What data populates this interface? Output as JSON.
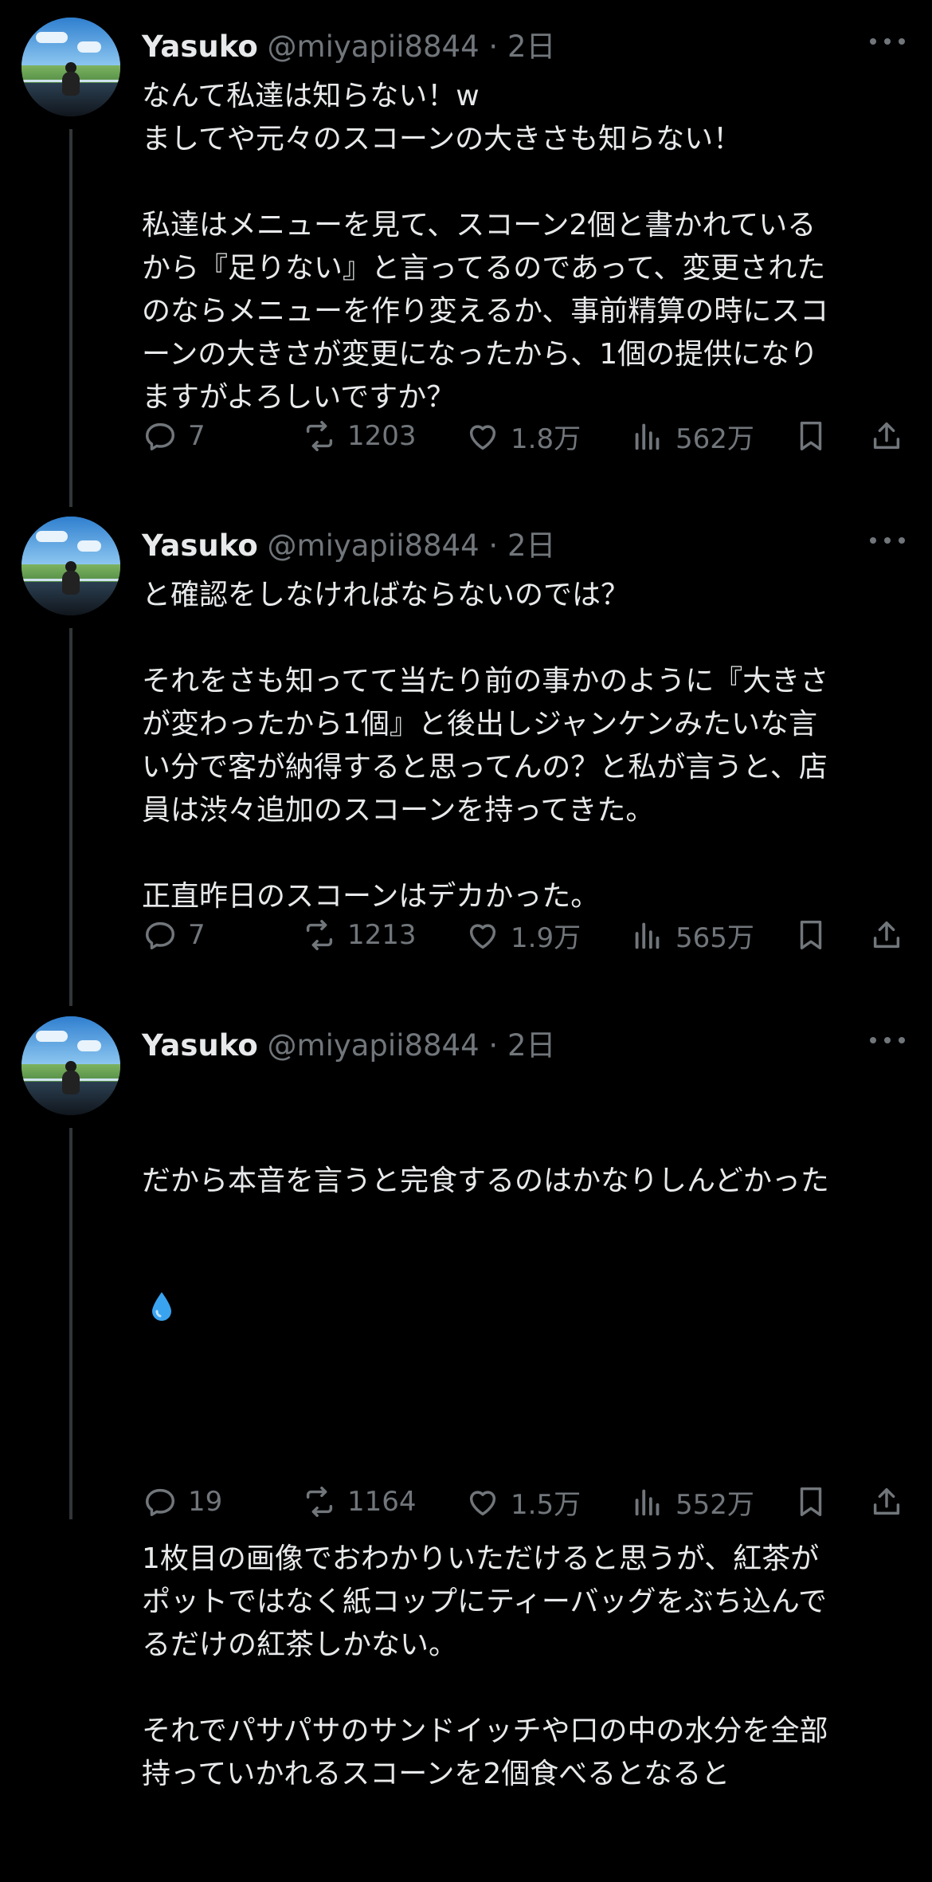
{
  "tweets": [
    {
      "name": "Yasuko",
      "handle": "@miyapii8844",
      "time": "2日",
      "text": "なんて私達は知らない！w\nましてや元々のスコーンの大きさも知らない！\n\n私達はメニューを見て、スコーン2個と書かれている\nから『足りない』と言ってるのであって、変更された\nのならメニューを作り変えるか、事前精算の時にスコ\nーンの大きさが変更になったから、1個の提供になり\nますがよろしいですか？",
      "replies": "7",
      "retweets": "1203",
      "likes": "1.8万",
      "views": "562万"
    },
    {
      "name": "Yasuko",
      "handle": "@miyapii8844",
      "time": "2日",
      "text": "と確認をしなければならないのでは？\n\nそれをさも知ってて当たり前の事かのように『大きさ\nが変わったから1個』と後出しジャンケンみたいな言\nい分で客が納得すると思ってんの？と私が言うと、店\n員は渋々追加のスコーンを持ってきた。\n\n正直昨日のスコーンはデカかった。",
      "replies": "7",
      "retweets": "1213",
      "likes": "1.9万",
      "views": "565万"
    },
    {
      "name": "Yasuko",
      "handle": "@miyapii8844",
      "time": "2日",
      "text": "だから本音を言うと完食するのはかなりしんどかった",
      "text_after": "1枚目の画像でおわかりいただけると思うが、紅茶が\nポットではなく紙コップにティーバッグをぶち込んで\nるだけの紅茶しかない。\n\nそれでパサパサのサンドイッチや口の中の水分を全部\n持っていかれるスコーンを2個食べるとなると",
      "emoji": "droplet-emoji",
      "replies": "19",
      "retweets": "1164",
      "likes": "1.5万",
      "views": "552万"
    }
  ],
  "separator": " · ",
  "colors": {
    "background": "#000000",
    "text": "#e7e9ea",
    "muted": "#71767b",
    "thread_line": "#333639"
  },
  "icons": [
    "reply-icon",
    "retweet-icon",
    "like-icon",
    "views-icon",
    "bookmark-icon",
    "share-icon",
    "more-icon",
    "avatar"
  ]
}
